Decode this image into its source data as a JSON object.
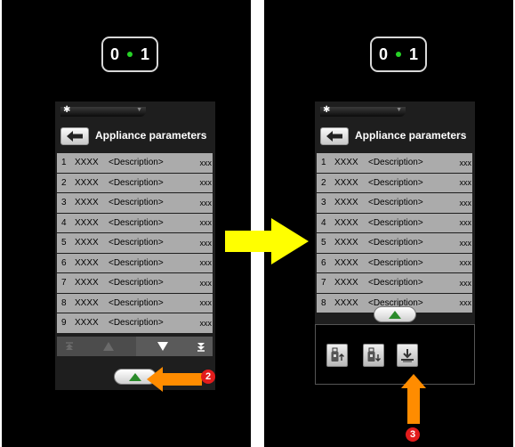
{
  "onoff": {
    "left": "0",
    "right": "1"
  },
  "screen": {
    "title": "Appliance parameters"
  },
  "rows": [
    {
      "num": "1",
      "code": "XXXX",
      "desc": "<Description>",
      "val": "xxx"
    },
    {
      "num": "2",
      "code": "XXXX",
      "desc": "<Description>",
      "val": "xxx"
    },
    {
      "num": "3",
      "code": "XXXX",
      "desc": "<Description>",
      "val": "xxx"
    },
    {
      "num": "4",
      "code": "XXXX",
      "desc": "<Description>",
      "val": "xxx"
    },
    {
      "num": "5",
      "code": "XXXX",
      "desc": "<Description>",
      "val": "xxx"
    },
    {
      "num": "6",
      "code": "XXXX",
      "desc": "<Description>",
      "val": "xxx"
    },
    {
      "num": "7",
      "code": "XXXX",
      "desc": "<Description>",
      "val": "xxx"
    },
    {
      "num": "8",
      "code": "XXXX",
      "desc": "<Description>",
      "val": "xxx"
    },
    {
      "num": "9",
      "code": "XXXX",
      "desc": "<Description>",
      "val": "xxx"
    }
  ],
  "steps": {
    "two": "2",
    "three": "3"
  },
  "colors": {
    "led": "#27d327",
    "callout": "#ff8c00",
    "transition": "#ffff00",
    "badge": "#e21c1c"
  },
  "icons": [
    "gear-icon",
    "back-arrow-icon",
    "scroll-top-icon",
    "scroll-up-icon",
    "scroll-down-icon",
    "scroll-bottom-icon",
    "pull-up-icon",
    "usb-upload-icon",
    "usb-download-icon",
    "download-icon"
  ]
}
